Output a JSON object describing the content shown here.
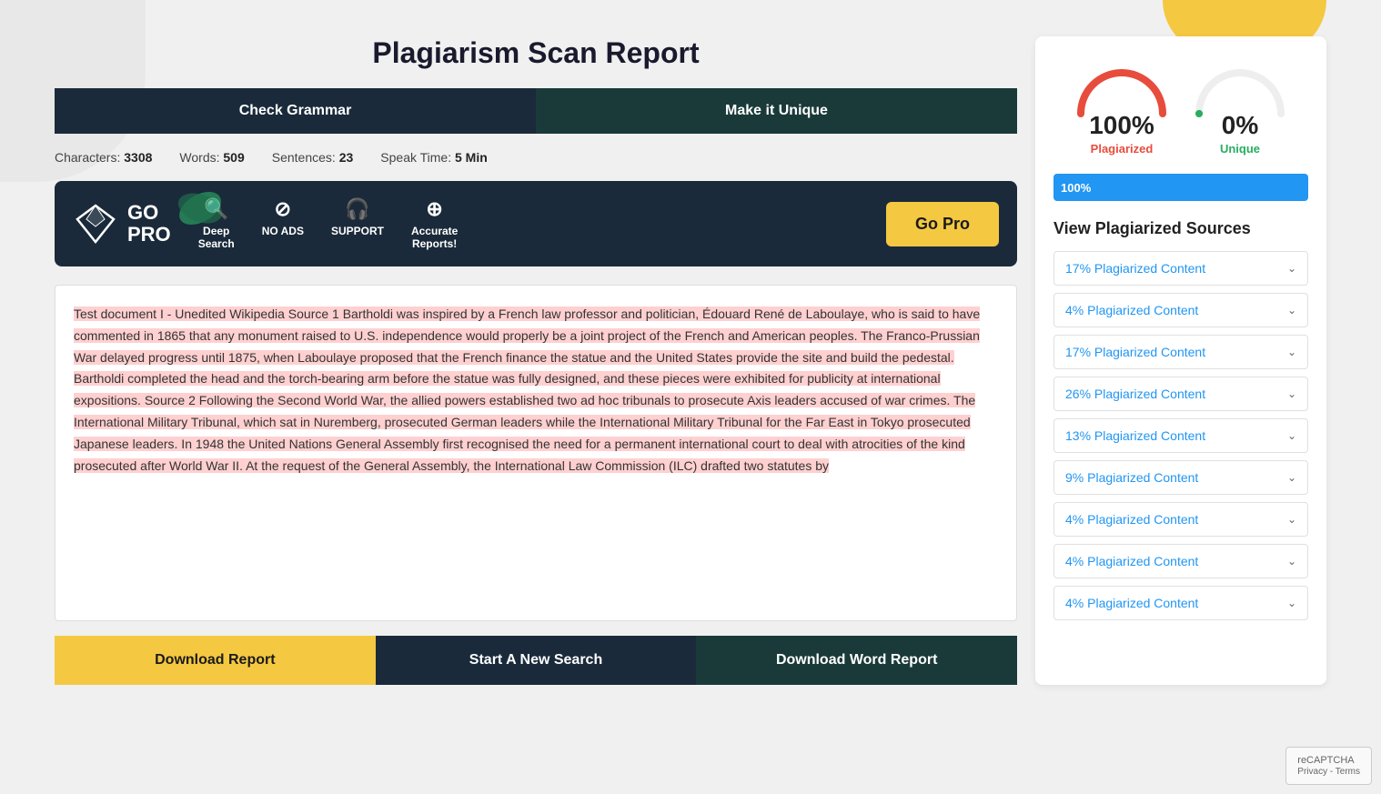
{
  "page": {
    "title": "Plagiarism Scan Report",
    "bg_shape_right_top": true
  },
  "top_buttons": {
    "check_grammar": "Check Grammar",
    "make_unique": "Make it Unique"
  },
  "stats": {
    "characters_label": "Characters:",
    "characters_value": "3308",
    "words_label": "Words:",
    "words_value": "509",
    "sentences_label": "Sentences:",
    "sentences_value": "23",
    "speak_time_label": "Speak Time:",
    "speak_time_value": "5 Min"
  },
  "go_pro_banner": {
    "logo_line1": "GO",
    "logo_line2": "PRO",
    "features": [
      {
        "icon": "🔍",
        "label": "Deep\nSearch"
      },
      {
        "icon": "⊘",
        "label": "NO ADS"
      },
      {
        "icon": "🎧",
        "label": "SUPPORT"
      },
      {
        "icon": "⊕",
        "label": "Accurate\nReports!"
      }
    ],
    "button_label": "Go Pro"
  },
  "document_text": "Test document I - Unedited Wikipedia Source 1  Bartholdi was inspired by a French law professor and politician, Édouard René de Laboulaye, who is said to have commented in 1865 that any monument raised to U.S.   independence would properly be a joint project of the French and American peoples.   The Franco-Prussian War delayed progress until 1875, when Laboulaye proposed that the French finance the statue and the United States provide the site and build the pedestal.   Bartholdi completed the head and the torch-bearing arm before the statue was fully designed, and these pieces were exhibited for publicity at international expositions.  Source 2  Following the Second World War, the allied powers established two ad hoc tribunals to prosecute Axis leaders accused of war crimes.   The International Military Tribunal, which sat in Nuremberg, prosecuted German leaders while the International Military Tribunal for the Far East in Tokyo prosecuted Japanese leaders.   In 1948 the United Nations General Assembly first recognised the need for a permanent international court to deal with atrocities of the kind prosecuted after World War II.   At the request of the General Assembly, the International Law Commission (ILC) drafted two statutes by",
  "bottom_buttons": {
    "download_report": "Download Report",
    "start_new_search": "Start A New Search",
    "download_word_report": "Download Word Report"
  },
  "right_panel": {
    "plagiarized_value": "100%",
    "plagiarized_label": "Plagiarized",
    "unique_value": "0%",
    "unique_label": "Unique",
    "progress_value": "100%",
    "progress_percent": 100,
    "sources_title": "View Plagiarized Sources",
    "sources": [
      {
        "label": "17% Plagiarized Content"
      },
      {
        "label": "4% Plagiarized Content"
      },
      {
        "label": "17% Plagiarized Content"
      },
      {
        "label": "26% Plagiarized Content"
      },
      {
        "label": "13% Plagiarized Content"
      },
      {
        "label": "9% Plagiarized Content"
      },
      {
        "label": "4% Plagiarized Content"
      },
      {
        "label": "4% Plagiarized Content"
      },
      {
        "label": "4% Plagiarized Content"
      }
    ]
  },
  "recaptcha": {
    "text": "reCAPTCHA\nPrivacy - Terms"
  }
}
